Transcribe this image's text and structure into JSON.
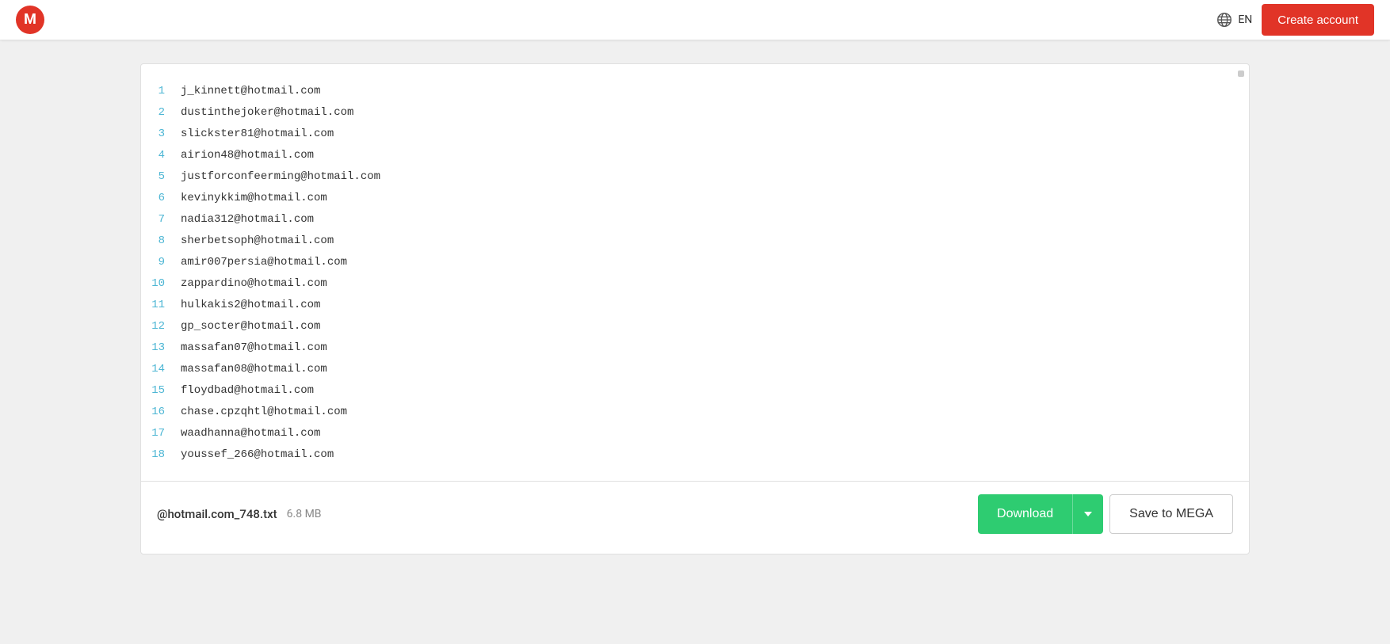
{
  "header": {
    "logo_text": "M",
    "lang_code": "EN",
    "create_account_label": "Create account"
  },
  "file_viewer": {
    "lines": [
      {
        "number": "1",
        "content": "j_kinnett@hotmail.com"
      },
      {
        "number": "2",
        "content": "dustinthejoker@hotmail.com"
      },
      {
        "number": "3",
        "content": "slickster81@hotmail.com"
      },
      {
        "number": "4",
        "content": "airion48@hotmail.com"
      },
      {
        "number": "5",
        "content": "justforconfeerming@hotmail.com"
      },
      {
        "number": "6",
        "content": "kevinykkim@hotmail.com"
      },
      {
        "number": "7",
        "content": "nadia312@hotmail.com"
      },
      {
        "number": "8",
        "content": "sherbetsoph@hotmail.com"
      },
      {
        "number": "9",
        "content": "amir007persia@hotmail.com"
      },
      {
        "number": "10",
        "content": "zappardino@hotmail.com"
      },
      {
        "number": "11",
        "content": "hulkakis2@hotmail.com"
      },
      {
        "number": "12",
        "content": "gp_socter@hotmail.com"
      },
      {
        "number": "13",
        "content": "massafan07@hotmail.com"
      },
      {
        "number": "14",
        "content": "massafan08@hotmail.com"
      },
      {
        "number": "15",
        "content": "floydbad@hotmail.com"
      },
      {
        "number": "16",
        "content": "chase.cpzqhtl@hotmail.com"
      },
      {
        "number": "17",
        "content": "waadhanna@hotmail.com"
      },
      {
        "number": "18",
        "content": "youssef_266@hotmail.com"
      }
    ]
  },
  "bottom_bar": {
    "file_name": "@hotmail.com_748.txt",
    "file_size": "6.8 MB",
    "download_label": "Download",
    "save_to_mega_label": "Save to MEGA"
  }
}
